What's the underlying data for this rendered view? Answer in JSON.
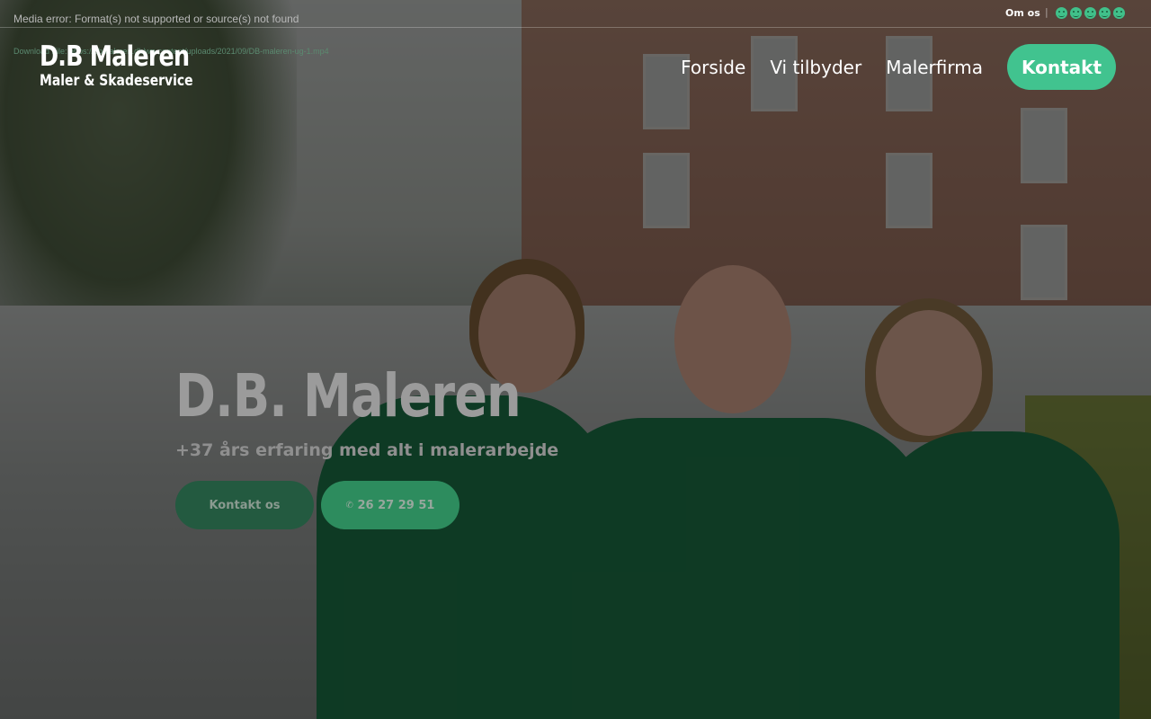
{
  "topbar": {
    "media_error": "Media error: Format(s) not supported or source(s) not found",
    "download_link": "Download File: https://dbmaleren.dk/wp-content/uploads/2021/09/DB-maleren-ug-1.mp4",
    "om_os": "Om os",
    "separator": "|",
    "rating_icons": [
      "smiley-icon",
      "smiley-icon",
      "smiley-icon",
      "smiley-icon",
      "smiley-icon"
    ],
    "rating_color": "#40c08a"
  },
  "logo": {
    "title": "D.B Maleren",
    "subtitle": "Maler & Skadeservice"
  },
  "nav": {
    "items": [
      {
        "label": "Forside"
      },
      {
        "label": "Vi tilbyder"
      },
      {
        "label": "Malerfirma"
      }
    ],
    "cta_label": "Kontakt",
    "cta_color": "#41c38f"
  },
  "hero": {
    "title": "D.B. Maleren",
    "subtitle": "+37 års erfaring med alt i malerarbejde",
    "buttons": {
      "contact_label": "Kontakt os",
      "phone_label": "26 27 29 51",
      "phone_icon": "phone-icon"
    }
  }
}
